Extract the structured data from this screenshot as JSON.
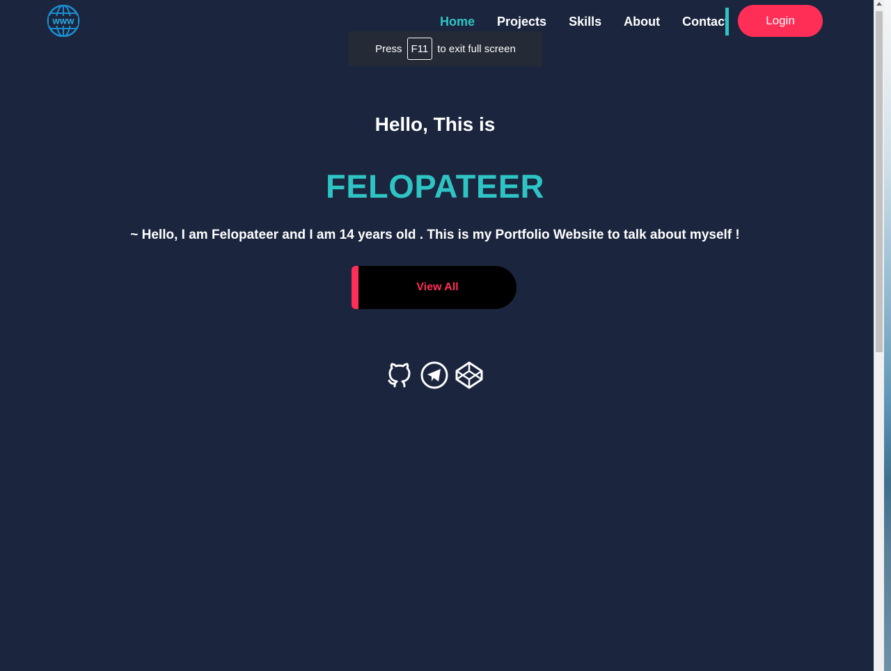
{
  "header": {
    "logo_text": "WWW",
    "nav": [
      {
        "label": "Home",
        "active": true
      },
      {
        "label": "Projects",
        "active": false
      },
      {
        "label": "Skills",
        "active": false
      },
      {
        "label": "About",
        "active": false
      },
      {
        "label": "Contact",
        "active": false
      }
    ],
    "login_label": "Login"
  },
  "fullscreen_toast": {
    "prefix": "Press",
    "key": "F11",
    "suffix": "to exit full screen"
  },
  "hero": {
    "greeting": "Hello, This is",
    "name": "FELOPATEER",
    "tagline": "~ Hello, I am Felopateer and I am 14 years old . This is my Portfolio Website to talk about myself !",
    "cta_label": "View All"
  },
  "social": [
    {
      "icon": "github-icon"
    },
    {
      "icon": "telegram-icon"
    },
    {
      "icon": "codepen-icon"
    }
  ],
  "colors": {
    "background": "#1b263e",
    "accent_teal": "#2ec4c4",
    "accent_red": "#ff2e57",
    "text": "#ffffff"
  }
}
